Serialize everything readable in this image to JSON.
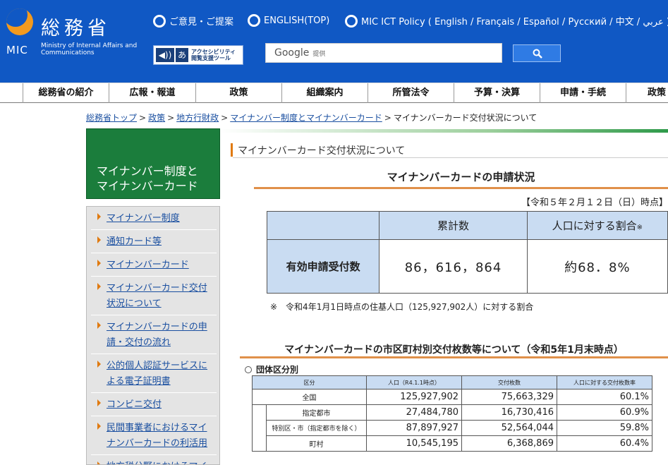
{
  "header": {
    "logo_kanji": "総務省",
    "logo_mic": "MIC",
    "logo_en": "Ministry of Internal Affairs and Communications",
    "top_links": [
      {
        "label": "ご意見・ご提案"
      },
      {
        "label": "ENGLISH(TOP)"
      },
      {
        "label": "MIC ICT Policy ( English / Français / Español / Русский / 中文 / عربي )"
      }
    ],
    "accessibility": {
      "icon": "あ",
      "line1": "アクセシビリティ",
      "line2": "閲覧支援ツール"
    },
    "search": {
      "brand": "Google",
      "suffix": "提供"
    },
    "colors": {
      "header_bg": "#1058c4",
      "accent": "#f39a1e"
    }
  },
  "nav": [
    "総務省の紹介",
    "広報・報道",
    "政策",
    "組織案内",
    "所管法令",
    "予算・決算",
    "申請・手続",
    "政策"
  ],
  "breadcrumb": {
    "links": [
      "総務省トップ",
      "政策",
      "地方行財政",
      "マイナンバー制度とマイナンバーカード"
    ],
    "separator": ">",
    "current": "マイナンバーカード交付状況について"
  },
  "sidebar": {
    "title_line1": "マイナンバー制度と",
    "title_line2": "マイナンバーカード",
    "items": [
      {
        "line1": "マイナンバー制度",
        "line2": ""
      },
      {
        "line1": "通知カード等",
        "line2": ""
      },
      {
        "line1": "マイナンバーカード",
        "line2": ""
      },
      {
        "line1": "マイナンバーカード交付",
        "line2": "状況について"
      },
      {
        "line1": "マイナンバーカードの申",
        "line2": "請・交付の流れ"
      },
      {
        "line1": "公的個人認証サービスに",
        "line2": "よる電子証明書"
      },
      {
        "line1": "コンビニ交付",
        "line2": ""
      },
      {
        "line1": "民間事業者におけるマイ",
        "line2": "ナンバーカードの利活用"
      },
      {
        "line1": "地方税分野におけるマイ",
        "line2": ""
      }
    ]
  },
  "main": {
    "page_title": "マイナンバーカード交付状況について",
    "section1": {
      "title": "マイナンバーカードの申請状況",
      "as_of": "【令和５年２月１２日（日）時点】",
      "col_total": "累計数",
      "col_ratio": "人口に対する割合",
      "col_ratio_mark": "※",
      "row_label": "有効申請受付数",
      "total": "86，616，864",
      "ratio": "約68．8%",
      "note": "※　令和4年1月1日時点の住基人口（125,927,902人）に対する割合"
    },
    "section2": {
      "title": "マイナンバーカードの市区町村別交付枚数等について（令和5年1月末時点）",
      "subtitle": "団体区分別",
      "headers": [
        "区分",
        "人口（R4.1.1時点）",
        "交付枚数",
        "人口に対する交付枚数率"
      ],
      "rows": [
        {
          "label": "全国",
          "population": "125,927,902",
          "issued": "75,663,329",
          "rate": "60.1%"
        },
        {
          "label": "指定都市",
          "population": "27,484,780",
          "issued": "16,730,416",
          "rate": "60.9%"
        },
        {
          "label": "特別区・市（指定都市を除く）",
          "population": "87,897,927",
          "issued": "52,564,044",
          "rate": "59.8%"
        },
        {
          "label": "町村",
          "population": "10,545,195",
          "issued": "6,368,869",
          "rate": "60.4%"
        }
      ]
    }
  }
}
